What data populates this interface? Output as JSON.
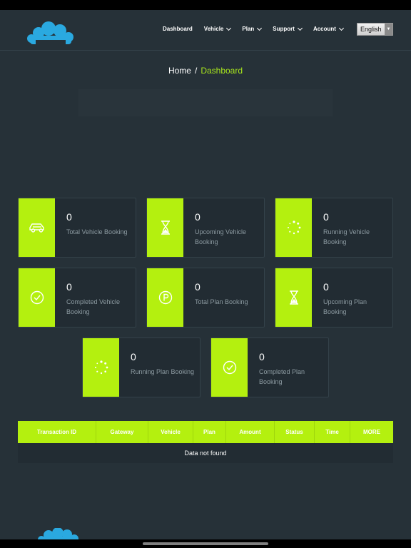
{
  "nav": {
    "items": [
      {
        "label": "Dashboard",
        "dropdown": false
      },
      {
        "label": "Vehicle",
        "dropdown": true
      },
      {
        "label": "Plan",
        "dropdown": true
      },
      {
        "label": "Support",
        "dropdown": true
      },
      {
        "label": "Account",
        "dropdown": true
      }
    ],
    "language": "English"
  },
  "breadcrumb": {
    "home": "Home",
    "separator": "/",
    "current": "Dashboard"
  },
  "cards": [
    {
      "value": "0",
      "label": "Total Vehicle Booking",
      "icon": "car-icon"
    },
    {
      "value": "0",
      "label": "Upcoming Vehicle Booking",
      "icon": "hourglass-icon"
    },
    {
      "value": "0",
      "label": "Running Vehicle Booking",
      "icon": "spinner-icon"
    },
    {
      "value": "0",
      "label": "Completed Vehicle Booking",
      "icon": "check-circle-icon"
    },
    {
      "value": "0",
      "label": "Total Plan Booking",
      "icon": "parking-icon"
    },
    {
      "value": "0",
      "label": "Upcoming Plan Booking",
      "icon": "hourglass-icon"
    },
    {
      "value": "0",
      "label": "Running Plan Booking",
      "icon": "spinner-icon"
    },
    {
      "value": "0",
      "label": "Completed Plan Booking",
      "icon": "check-circle-icon"
    }
  ],
  "table": {
    "columns": [
      "Transaction ID",
      "Gateway",
      "Vehicle",
      "Plan",
      "Amount",
      "Status",
      "Time",
      "MORE"
    ],
    "empty_message": "Data not found"
  },
  "colors": {
    "accent": "#b4f00f",
    "background": "#263138",
    "card": "#222c33",
    "logo": "#2aa9e0"
  }
}
